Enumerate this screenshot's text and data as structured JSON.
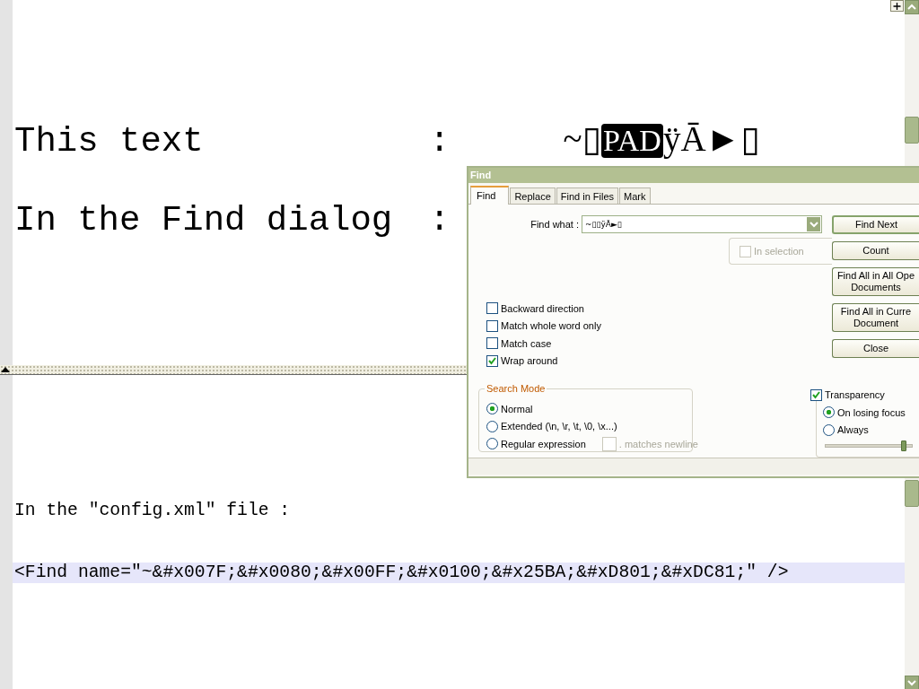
{
  "editor_top": {
    "lines": [
      {
        "label": "This text",
        "colon": ":",
        "value": [
          {
            "text": "~",
            "kind": "plain"
          },
          {
            "text": "▯",
            "kind": "missing"
          },
          {
            "text": "PAD",
            "kind": "control"
          },
          {
            "text": "ÿĀ►",
            "kind": "plain"
          },
          {
            "text": "▯",
            "kind": "missing"
          }
        ]
      },
      {
        "label": "In the Find dialog",
        "colon": ":"
      }
    ]
  },
  "editor_bottom": {
    "lines": [
      {
        "text": "In the \"config.xml\" file :",
        "current": false
      },
      {
        "text": "<Find name=\"~&#x007F;&#x0080;&#x00FF;&#x0100;&#x25BA;&#xD801;&#xDC81;\" />",
        "current": true
      }
    ]
  },
  "find_dialog": {
    "title": "Find",
    "tabs": [
      {
        "label": "Find",
        "selected": true
      },
      {
        "label": "Replace",
        "selected": false
      },
      {
        "label": "Find in Files",
        "selected": false
      },
      {
        "label": "Mark",
        "selected": false
      }
    ],
    "find_what": {
      "label": "Find what :",
      "value": "~▯▯ÿĀ►▯"
    },
    "in_selection": {
      "label": "In selection",
      "checked": false,
      "disabled": true
    },
    "options": [
      {
        "label": "Backward direction",
        "checked": false
      },
      {
        "label": "Match whole word only",
        "checked": false
      },
      {
        "label": "Match case",
        "checked": false
      },
      {
        "label": "Wrap around",
        "checked": true
      }
    ],
    "search_mode": {
      "title": "Search Mode",
      "modes": [
        {
          "label": "Normal",
          "selected": true
        },
        {
          "label": "Extended (\\n, \\r, \\t, \\0, \\x...)",
          "selected": false
        },
        {
          "label": "Regular expression",
          "selected": false
        }
      ],
      "dot_matches": {
        "label": ". matches newline",
        "checked": false,
        "disabled": true
      }
    },
    "buttons": [
      {
        "lines": [
          "Find Next"
        ],
        "default": true
      },
      {
        "lines": [
          "Count"
        ],
        "default": false
      },
      {
        "lines": [
          "Find All in All Ope",
          "Documents"
        ],
        "default": false
      },
      {
        "lines": [
          "Find All in Curre",
          "Document"
        ],
        "default": false
      },
      {
        "lines": [
          "Close"
        ],
        "default": false
      }
    ],
    "transparency": {
      "label": "Transparency",
      "checked": true,
      "modes": [
        {
          "label": "On losing focus",
          "selected": true
        },
        {
          "label": "Always",
          "selected": false
        }
      ],
      "level": 0.88
    }
  }
}
